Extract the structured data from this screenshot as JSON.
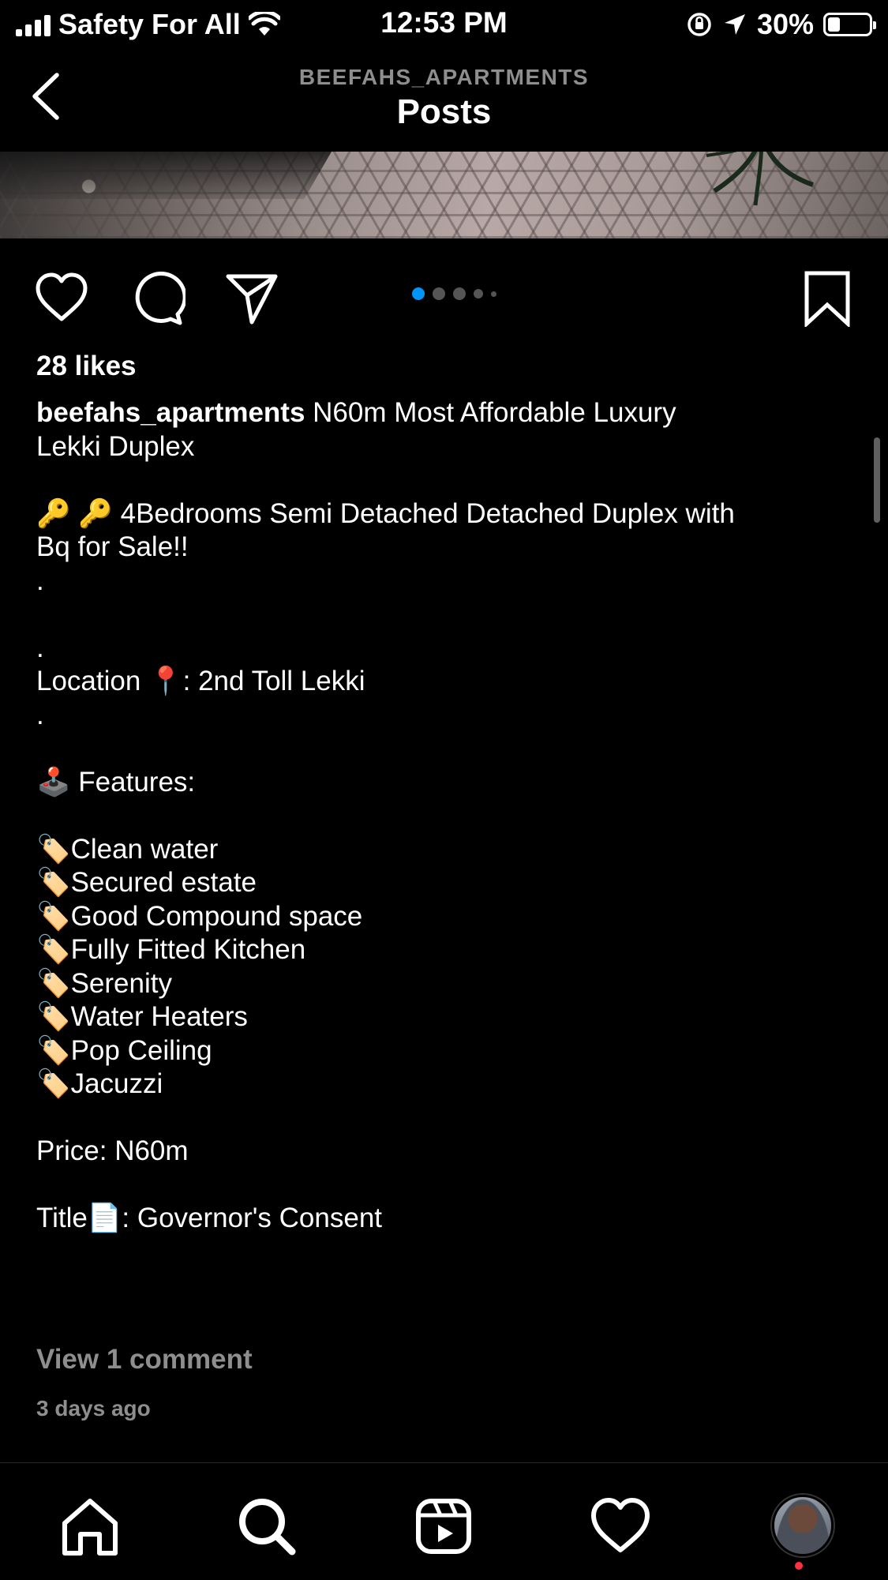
{
  "status_bar": {
    "carrier": "Safety For All",
    "time": "12:53 PM",
    "battery_percent": "30%",
    "battery_level": 0.3
  },
  "header": {
    "account": "BEEFAHS_APARTMENTS",
    "title": "Posts"
  },
  "post": {
    "carousel": {
      "count": 5,
      "active_index": 0
    },
    "likes": "28 likes",
    "username": "beefahs_apartments",
    "caption": " N60m Most Affordable Luxury\nLekki Duplex\n\n🔑 🔑 4Bedrooms Semi Detached Detached Duplex with\nBq for Sale!!\n.\n\n.\nLocation 📍: 2nd Toll Lekki\n.\n\n🕹️ Features:\n\n🏷️Clean water\n🏷️Secured estate\n🏷️Good Compound space\n🏷️Fully Fitted Kitchen\n🏷️Serenity\n🏷️Water Heaters\n🏷️Pop Ceiling\n🏷️Jacuzzi\n\nPrice: N60m\n\nTitle📄: Governor's Consent",
    "view_comments": "View 1 comment",
    "timestamp": "3 days ago"
  },
  "tabbar": {
    "items": [
      "home-icon",
      "search-icon",
      "reels-icon",
      "activity-heart-icon",
      "profile-avatar"
    ],
    "profile_has_notification": true
  },
  "colors": {
    "background": "#000000",
    "secondary_text": "#8e8e8e",
    "carousel_active": "#0095f6",
    "notification": "#ff3040"
  }
}
